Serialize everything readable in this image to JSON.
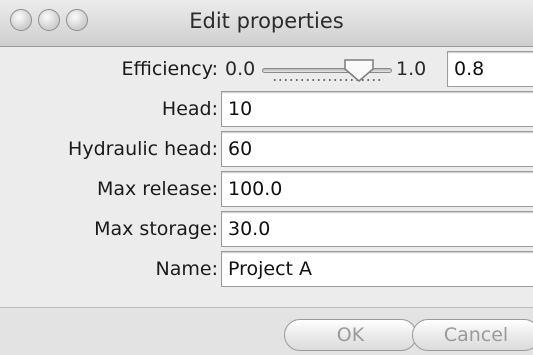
{
  "window": {
    "title": "Edit properties",
    "controls": [
      "close-button",
      "minimize-button",
      "zoom-button"
    ]
  },
  "efficiency": {
    "label": "Efficiency:",
    "slider_min": "0.0",
    "slider_max": "1.0",
    "slider_value": 0.8,
    "value": "0.8"
  },
  "fields": {
    "head": {
      "label": "Head:",
      "value": "10"
    },
    "hydraulic_head": {
      "label": "Hydraulic head:",
      "value": "60"
    },
    "max_release": {
      "label": "Max release:",
      "value": "100.0"
    },
    "max_storage": {
      "label": "Max storage:",
      "value": "30.0"
    },
    "name": {
      "label": "Name:",
      "value": "Project A"
    }
  },
  "buttons": {
    "ok": "OK",
    "cancel": "Cancel"
  },
  "colors": {
    "window_bg": "#ececec",
    "disabled_text": "#9a9a9a"
  }
}
